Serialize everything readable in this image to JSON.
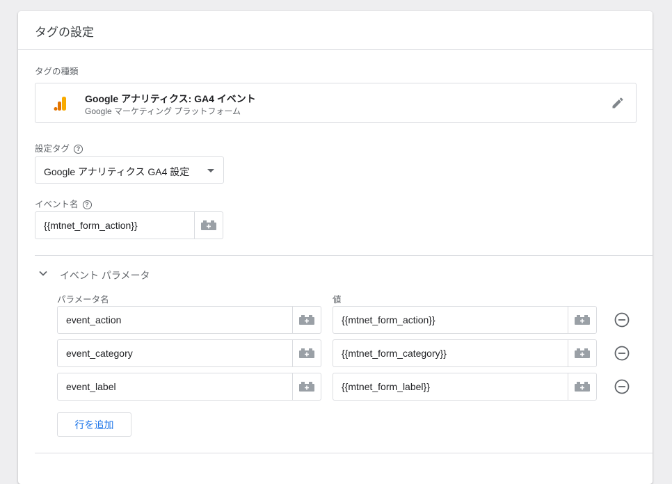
{
  "card": {
    "title": "タグの設定"
  },
  "tag_type": {
    "label": "タグの種類",
    "name": "Google アナリティクス: GA4 イベント",
    "platform": "Google マーケティング プラットフォーム",
    "icon": "analytics-icon",
    "icon_colors": [
      "#F9AB00",
      "#E37400"
    ]
  },
  "config_tag": {
    "label": "設定タグ",
    "help": "?",
    "selected": "Google アナリティクス GA4 設定"
  },
  "event_name": {
    "label": "イベント名",
    "help": "?",
    "value": "{{mtnet_form_action}}"
  },
  "event_params": {
    "title": "イベント パラメータ",
    "name_header": "パラメータ名",
    "value_header": "値",
    "rows": [
      {
        "name": "event_action",
        "value": "{{mtnet_form_action}}"
      },
      {
        "name": "event_category",
        "value": "{{mtnet_form_category}}"
      },
      {
        "name": "event_label",
        "value": "{{mtnet_form_label}}"
      }
    ],
    "add_row_label": "行を追加"
  },
  "colors": {
    "link": "#1a73e8",
    "border": "#dadce0"
  }
}
